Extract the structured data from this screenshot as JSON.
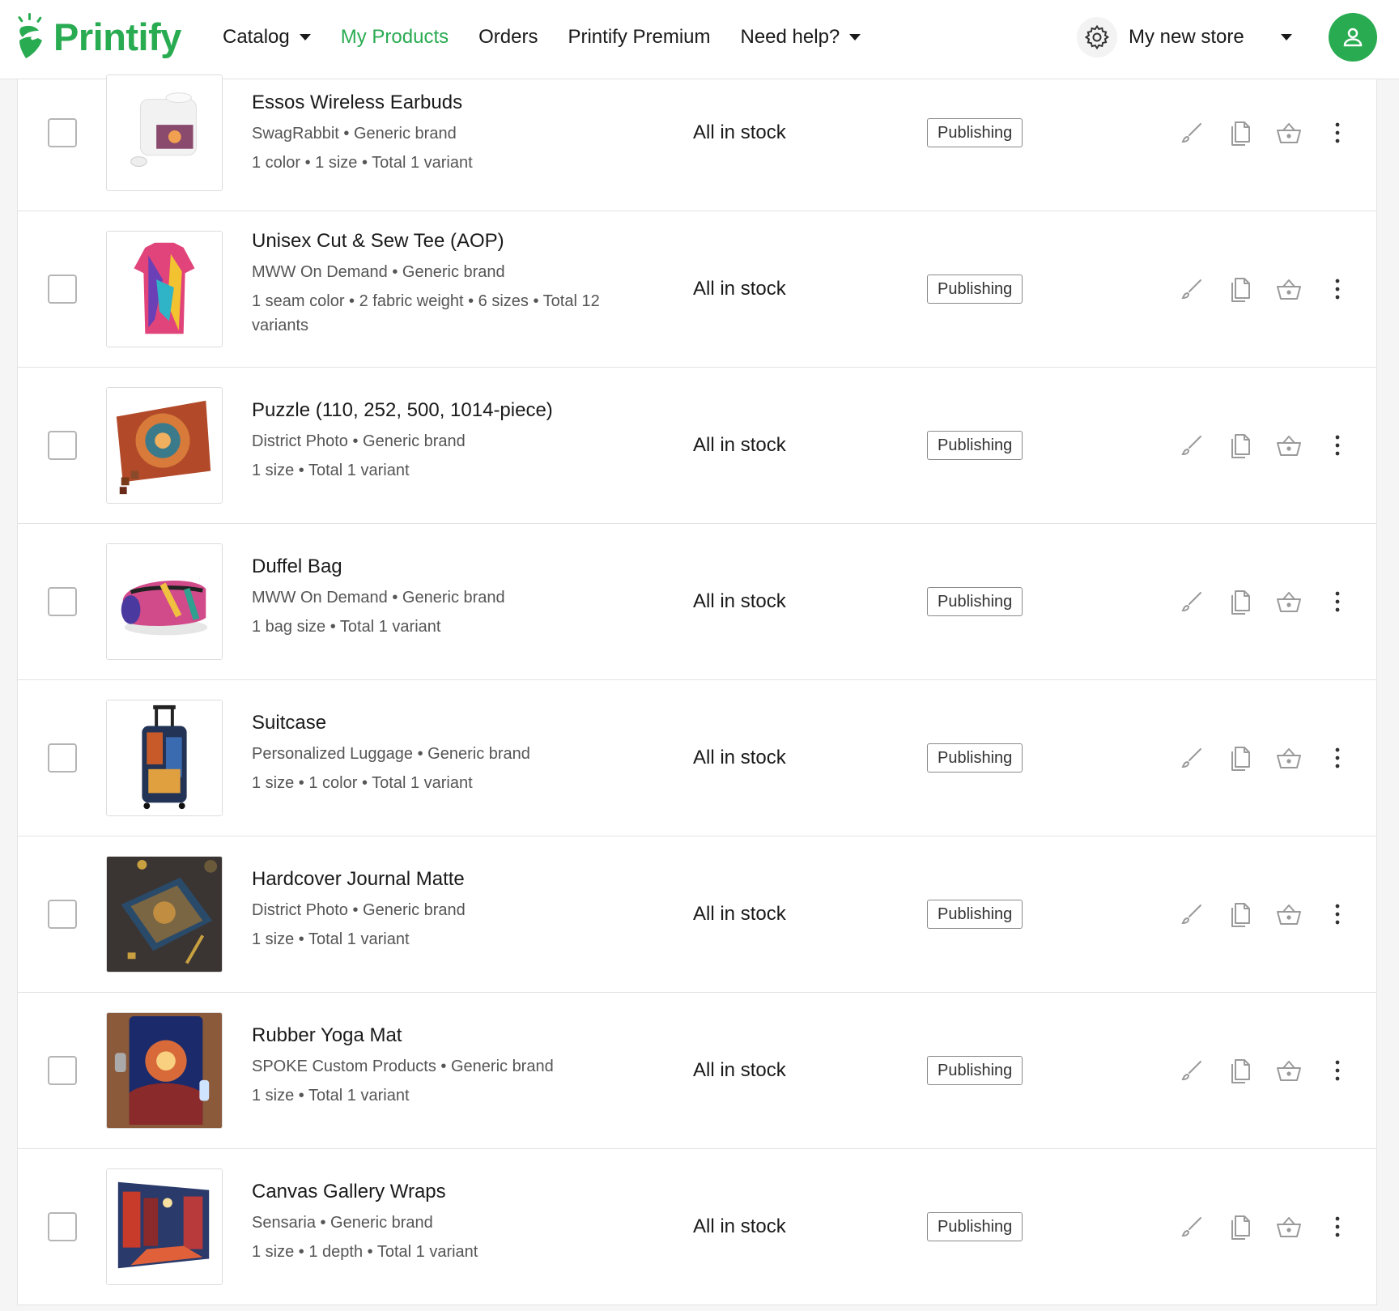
{
  "brand": {
    "name": "Printify",
    "accent": "#29ab51"
  },
  "nav": {
    "items": [
      {
        "label": "Catalog",
        "dropdown": true
      },
      {
        "label": "My Products",
        "active": true
      },
      {
        "label": "Orders"
      },
      {
        "label": "Printify Premium"
      },
      {
        "label": "Need help?",
        "dropdown": true
      }
    ]
  },
  "store": {
    "name": "My new store"
  },
  "products": [
    {
      "title": "Essos Wireless Earbuds",
      "provider": "SwagRabbit • Generic brand",
      "variants": "1 color • 1 size • Total 1 variant",
      "stock": "All in stock",
      "status": "Publishing",
      "thumb": "earbuds"
    },
    {
      "title": "Unisex Cut & Sew Tee (AOP)",
      "provider": "MWW On Demand • Generic brand",
      "variants": "1 seam color • 2 fabric weight • 6 sizes • Total 12 variants",
      "stock": "All in stock",
      "status": "Publishing",
      "thumb": "tee"
    },
    {
      "title": "Puzzle (110, 252, 500, 1014-piece)",
      "provider": "District Photo • Generic brand",
      "variants": "1 size • Total 1 variant",
      "stock": "All in stock",
      "status": "Publishing",
      "thumb": "puzzle"
    },
    {
      "title": "Duffel Bag",
      "provider": "MWW On Demand • Generic brand",
      "variants": "1 bag size • Total 1 variant",
      "stock": "All in stock",
      "status": "Publishing",
      "thumb": "duffel"
    },
    {
      "title": "Suitcase",
      "provider": "Personalized Luggage • Generic brand",
      "variants": "1 size • 1 color • Total 1 variant",
      "stock": "All in stock",
      "status": "Publishing",
      "thumb": "suitcase"
    },
    {
      "title": "Hardcover Journal Matte",
      "provider": "District Photo • Generic brand",
      "variants": "1 size • Total 1 variant",
      "stock": "All in stock",
      "status": "Publishing",
      "thumb": "journal"
    },
    {
      "title": "Rubber Yoga Mat",
      "provider": "SPOKE Custom Products • Generic brand",
      "variants": "1 size • Total 1 variant",
      "stock": "All in stock",
      "status": "Publishing",
      "thumb": "yoga"
    },
    {
      "title": "Canvas Gallery Wraps",
      "provider": "Sensaria • Generic brand",
      "variants": "1 size • 1 depth • Total 1 variant",
      "stock": "All in stock",
      "status": "Publishing",
      "thumb": "canvas"
    }
  ],
  "row_actions": [
    "edit-icon",
    "duplicate-icon",
    "publish-basket-icon",
    "more-vertical-icon"
  ]
}
